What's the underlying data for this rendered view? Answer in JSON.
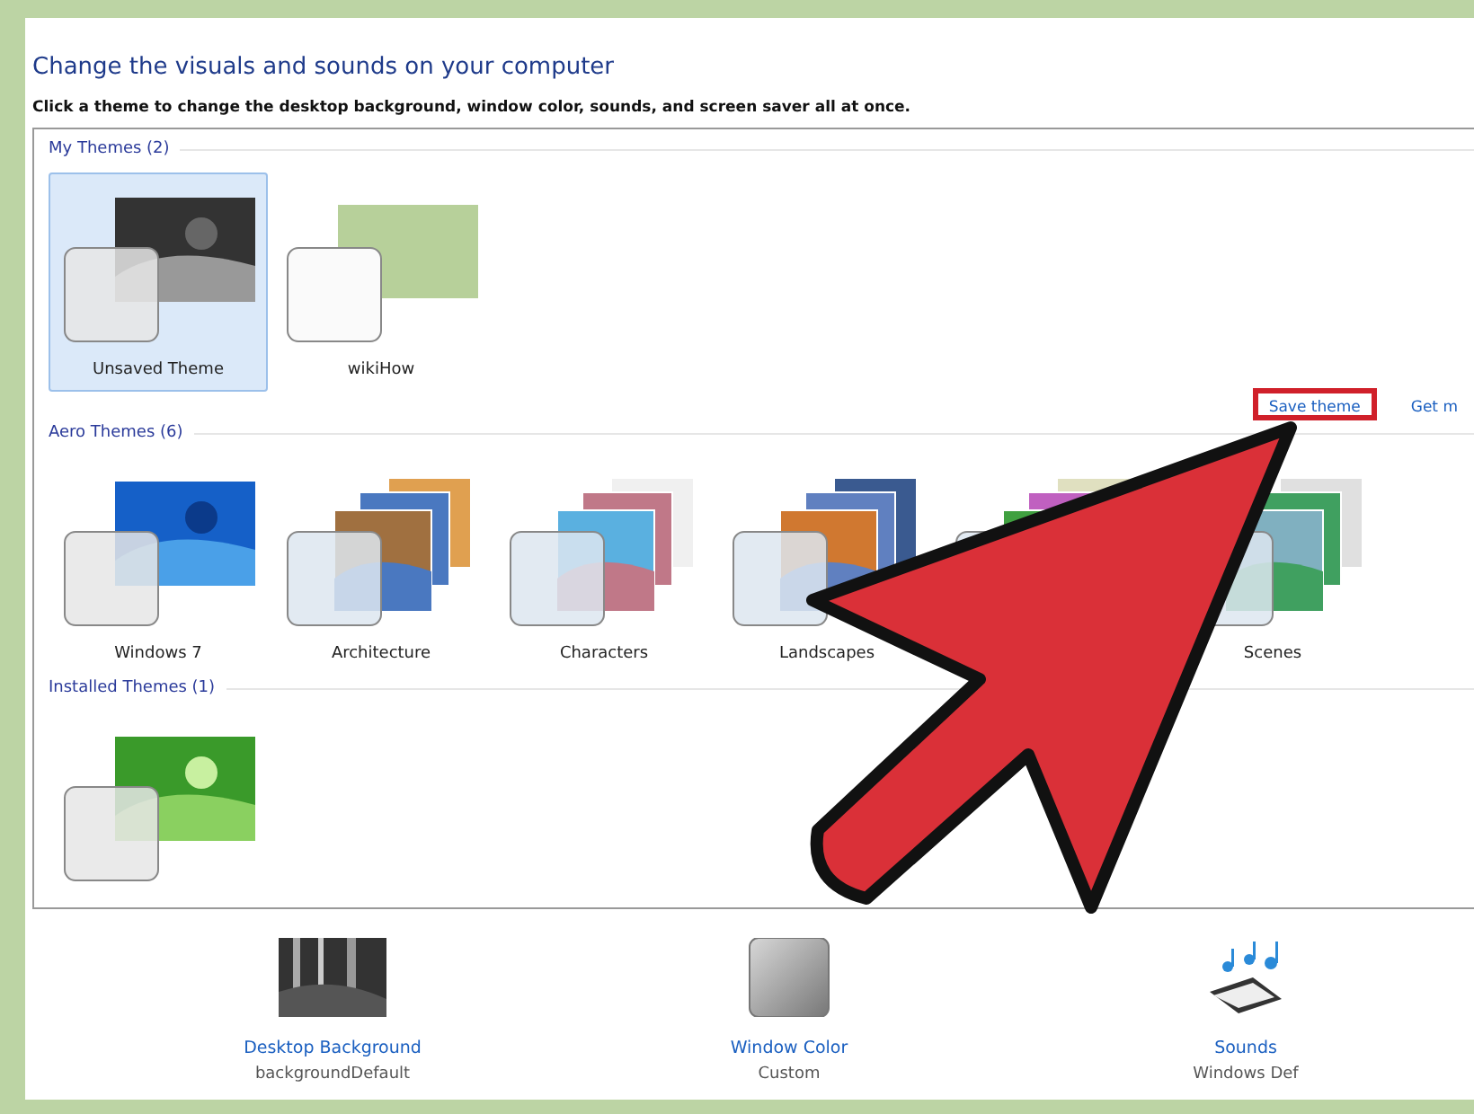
{
  "heading": "Change the visuals and sounds on your computer",
  "instruction": "Click a theme to change the desktop background, window color, sounds, and screen saver all at once.",
  "groups": [
    {
      "title": "My Themes (2)",
      "themes": [
        {
          "label": "Unsaved Theme",
          "kind": "single",
          "selected": true
        },
        {
          "label": "wikiHow",
          "kind": "plain",
          "selected": false
        }
      ],
      "links": [
        {
          "label": "Save theme",
          "highlighted": true
        },
        {
          "label": "Get m",
          "highlighted": false
        }
      ]
    },
    {
      "title": "Aero Themes (6)",
      "themes": [
        {
          "label": "Windows 7",
          "kind": "single",
          "selected": false
        },
        {
          "label": "Architecture",
          "kind": "stack",
          "selected": false
        },
        {
          "label": "Characters",
          "kind": "stack",
          "selected": false
        },
        {
          "label": "Landscapes",
          "kind": "stack",
          "selected": false
        },
        {
          "kind": "stack",
          "selected": false
        },
        {
          "label": "Scenes",
          "kind": "stack",
          "selected": false
        }
      ]
    },
    {
      "title": "Installed Themes (1)",
      "themes": [
        {
          "kind": "single",
          "selected": false
        }
      ]
    }
  ],
  "settings": [
    {
      "label": "Desktop Background",
      "value": "backgroundDefault",
      "kind": "picture"
    },
    {
      "label": "Window Color",
      "value": "Custom",
      "kind": "color"
    },
    {
      "label": "Sounds",
      "value": "Windows Def",
      "kind": "sound"
    }
  ]
}
